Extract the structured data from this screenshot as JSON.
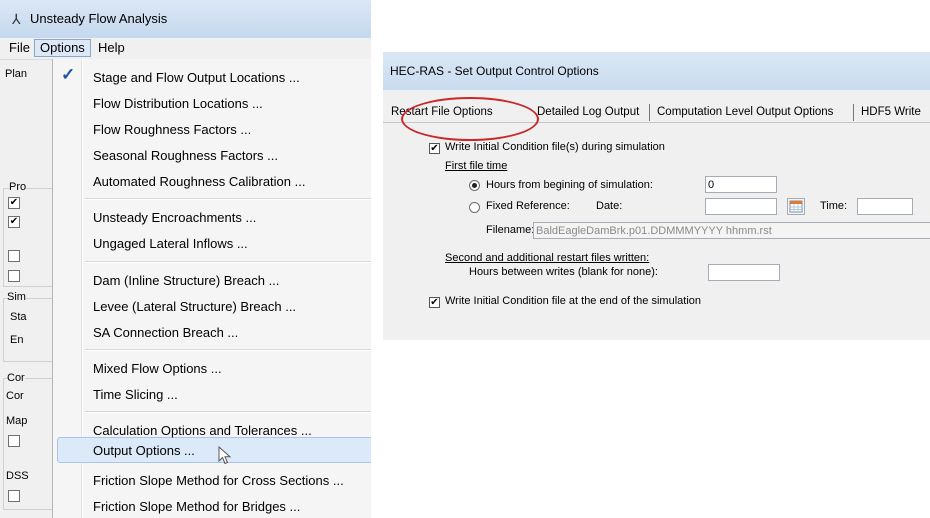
{
  "left_window": {
    "title": "Unsteady Flow Analysis",
    "menu": [
      "File",
      "Options",
      "Help"
    ],
    "background_labels": {
      "plan": "Plan",
      "pro": "Pro",
      "sim": "Sim",
      "sta": "Sta",
      "en": "En",
      "cor1": "Cor",
      "cor2": "Cor",
      "map": "Map",
      "dss": "DSS"
    },
    "dropdown_items": [
      "Stage and Flow Output Locations ...",
      "Flow Distribution Locations ...",
      "Flow Roughness Factors ...",
      "Seasonal Roughness Factors ...",
      "Automated Roughness Calibration ...",
      "Unsteady Encroachments ...",
      "Ungaged Lateral Inflows ...",
      "Dam (Inline Structure) Breach ...",
      "Levee (Lateral Structure) Breach ...",
      "SA Connection Breach ...",
      "Mixed Flow Options ...",
      "Time Slicing ...",
      "Calculation Options and Tolerances ...",
      "Output Options ...",
      "Friction Slope Method for Cross Sections ...",
      "Friction Slope Method for Bridges ..."
    ],
    "checked_item": "Stage and Flow Output Locations ...",
    "hovered_item": "Output Options ..."
  },
  "right_window": {
    "title": "HEC-RAS - Set Output Control Options",
    "tabs": [
      "Restart File Options",
      "Detailed Log Output",
      "Computation Level Output Options",
      "HDF5 Write"
    ],
    "active_tab": "Restart File Options",
    "write_initial_label": "Write Initial Condition file(s) during simulation",
    "write_initial_checked": true,
    "first_file_time_label": "First file time",
    "hours_from_label": "Hours from begining of simulation:",
    "hours_from_value": "0",
    "fixed_ref_label": "Fixed Reference:",
    "date_label": "Date:",
    "date_value": "",
    "time_label": "Time:",
    "time_value": "",
    "filename_label": "Filename:",
    "filename_value": "BaldEagleDamBrk.p01.DDMMMYYYY hhmm.rst",
    "second_label": "Second and additional restart files written:",
    "hours_between_label": "Hours between writes (blank for none):",
    "hours_between_value": "",
    "write_end_label": "Write Initial Condition file at the end of the simulation",
    "write_end_checked": true
  },
  "colors": {
    "highlight": "#dce9f8",
    "annotation": "#c8282a",
    "check": "#1f56a8"
  }
}
